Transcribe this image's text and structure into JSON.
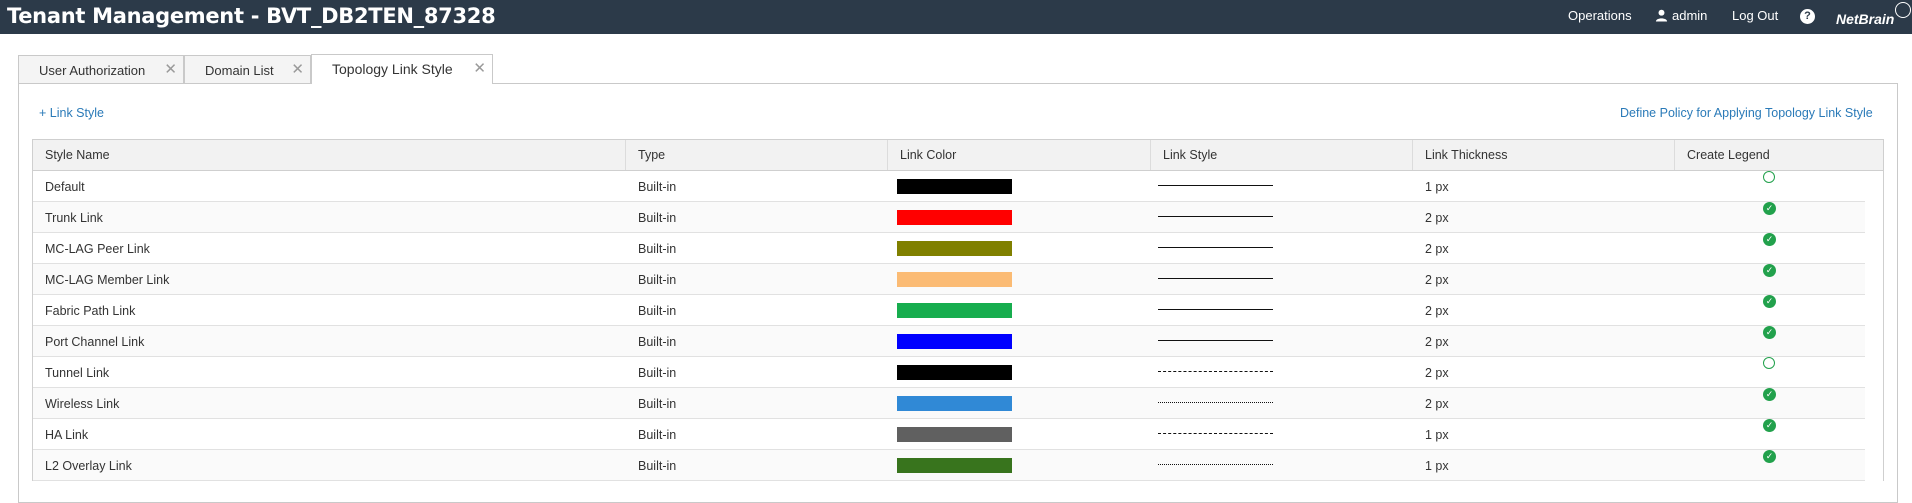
{
  "header": {
    "title": "Tenant Management - BVT_DB2TEN_87328",
    "operations_label": "Operations",
    "user_label": "admin",
    "logout_label": "Log Out",
    "help_symbol": "?",
    "logo_text": "NetBrain"
  },
  "tabs": [
    {
      "label": "User Authorization",
      "close": "✕"
    },
    {
      "label": "Domain List",
      "close": "✕"
    },
    {
      "label": "Topology Link Style",
      "close": "✕"
    }
  ],
  "actions": {
    "add_label": "+  Link Style",
    "policy_label": "Define Policy for Applying Topology Link Style"
  },
  "table": {
    "columns": [
      "Style Name",
      "Type",
      "Link Color",
      "Link Style",
      "Link Thickness",
      "Create Legend"
    ],
    "rows": [
      {
        "name": "Default",
        "type": "Built-in",
        "color": "#000000",
        "style": "solid",
        "thickness": "1 px",
        "legend": false
      },
      {
        "name": "Trunk Link",
        "type": "Built-in",
        "color": "#ff0000",
        "style": "solid",
        "thickness": "2 px",
        "legend": true
      },
      {
        "name": "MC-LAG Peer Link",
        "type": "Built-in",
        "color": "#808000",
        "style": "solid",
        "thickness": "2 px",
        "legend": true
      },
      {
        "name": "MC-LAG Member Link",
        "type": "Built-in",
        "color": "#fbbb74",
        "style": "solid",
        "thickness": "2 px",
        "legend": true
      },
      {
        "name": "Fabric Path Link",
        "type": "Built-in",
        "color": "#17ad4e",
        "style": "solid",
        "thickness": "2 px",
        "legend": true
      },
      {
        "name": "Port Channel Link",
        "type": "Built-in",
        "color": "#0000ff",
        "style": "solid",
        "thickness": "2 px",
        "legend": true
      },
      {
        "name": "Tunnel Link",
        "type": "Built-in",
        "color": "#000000",
        "style": "dashed",
        "thickness": "2 px",
        "legend": false
      },
      {
        "name": "Wireless Link",
        "type": "Built-in",
        "color": "#3089d6",
        "style": "dotted",
        "thickness": "2 px",
        "legend": true
      },
      {
        "name": "HA Link",
        "type": "Built-in",
        "color": "#606060",
        "style": "dash-dot",
        "thickness": "1 px",
        "legend": true
      },
      {
        "name": "L2 Overlay Link",
        "type": "Built-in",
        "color": "#38741d",
        "style": "dotted",
        "thickness": "1 px",
        "legend": true
      }
    ]
  }
}
